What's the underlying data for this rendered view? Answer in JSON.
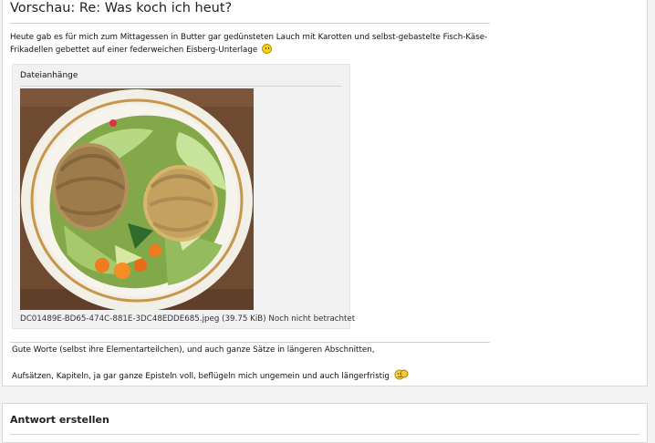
{
  "preview": {
    "title": "Vorschau: Re: Was koch ich heut?",
    "body_text": "Heute gab es für mich zum Mittagessen in Butter gar gedünsteten Lauch mit Karotten und selbst-gebastelte Fisch-Käse-Frikadellen gebettet auf einer federweichen Eisberg-Unterlage",
    "body_emoticon": "smile-emoticon",
    "attachments": {
      "heading": "Dateianhänge",
      "file": {
        "name": "DC01489E-BD65-474C-881E-3DC48EDDE685.jpeg",
        "size": "(39.75 KiB)",
        "status": "Noch nicht betrachtet"
      }
    },
    "signature": {
      "line1": "Gute Worte (selbst ihre Elementarteilchen), und auch ganze Sätze in längeren Abschnitten,",
      "line2": "Aufsätzen, Kapiteln, ja gar ganze Episteln voll, beflügeln mich ungemein und auch längerfristig",
      "emoticon": "hug-emoticon"
    }
  },
  "reply": {
    "title": "Antwort erstellen"
  },
  "colors": {
    "page_bg": "#f4f4f4",
    "panel_bg": "#ffffff",
    "attachment_bg": "#f1f1f1",
    "rule": "#cfcfcf",
    "plate_rim": "#c7964a"
  }
}
